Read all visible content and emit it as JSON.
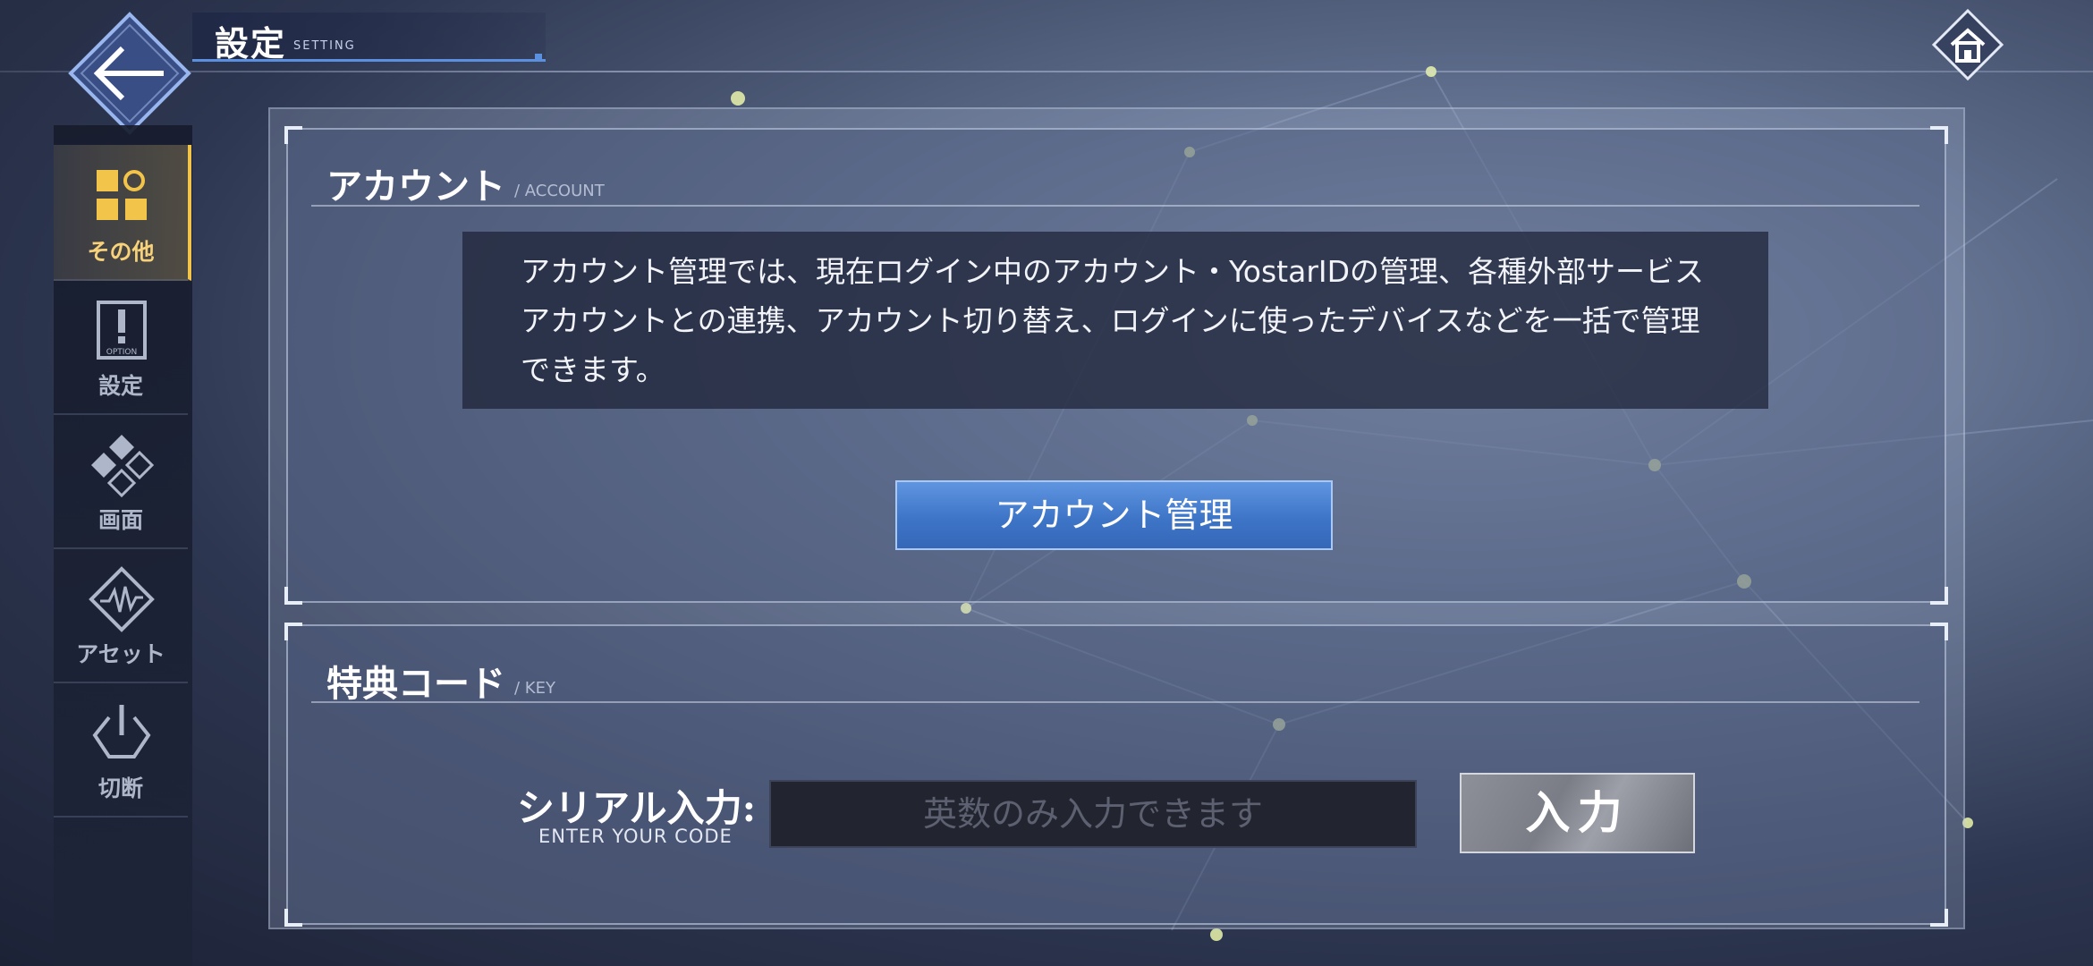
{
  "header": {
    "title": "設定",
    "subtitle": "SETTING",
    "back_icon": "arrow-left-icon",
    "home_icon": "home-icon"
  },
  "sidebar": {
    "items": [
      {
        "label": "その他",
        "icon": "grid-shapes-icon",
        "active": true
      },
      {
        "label": "設定",
        "icon": "option-icon",
        "icon_text": "OPTION",
        "active": false
      },
      {
        "label": "画面",
        "icon": "diamond-screen-icon",
        "active": false
      },
      {
        "label": "アセット",
        "icon": "asset-waveform-icon",
        "active": false
      },
      {
        "label": "切断",
        "icon": "power-icon",
        "active": false
      }
    ]
  },
  "account": {
    "title": "アカウント",
    "subtitle": "/ ACCOUNT",
    "description": "アカウント管理では、現在ログイン中のアカウント・YostarIDの管理、各種外部サービスアカウントとの連携、アカウント切り替え、ログインに使ったデバイスなどを一括で管理できます。",
    "button_label": "アカウント管理"
  },
  "key": {
    "title": "特典コード",
    "subtitle": "/ KEY",
    "serial_label": "シリアル入力:",
    "serial_sublabel": "ENTER YOUR CODE",
    "input_value": "",
    "input_placeholder": "英数のみ入力できます",
    "enter_button_label": "入力"
  },
  "colors": {
    "accent_blue": "#3e75c7",
    "active_gold": "#f3c44a",
    "enter_button_gray": "#7a7d86"
  }
}
